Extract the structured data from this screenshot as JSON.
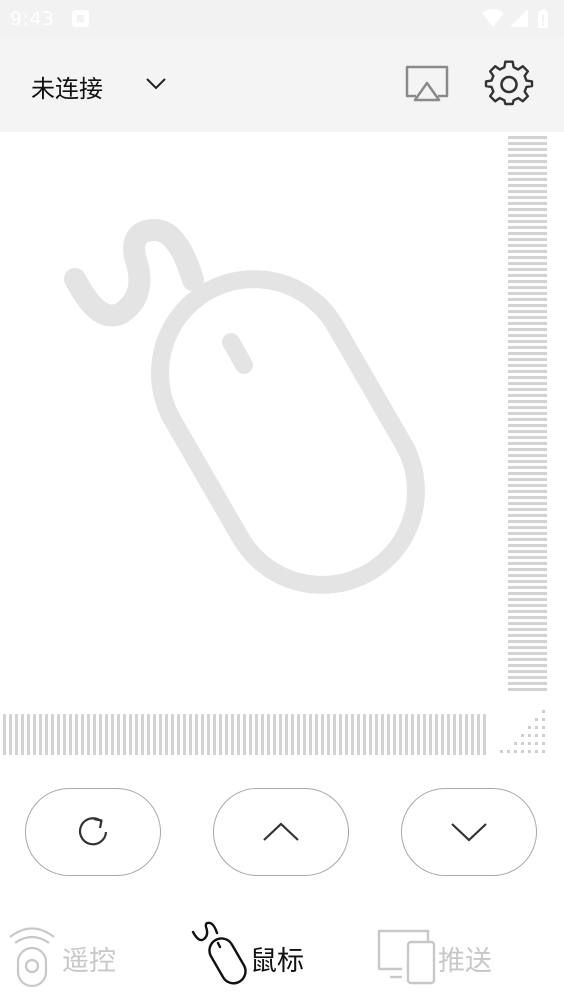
{
  "status_bar": {
    "time": "9:43"
  },
  "header": {
    "connection_label": "未连接"
  },
  "icons": {
    "mouse_art": "mouse-icon",
    "cast": "cast-icon",
    "settings": "gear-icon",
    "refresh": "refresh-icon",
    "up": "chevron-up-icon",
    "down": "chevron-down-icon"
  },
  "nav": {
    "items": [
      {
        "label": "遥控",
        "icon": "remote-icon",
        "active": false
      },
      {
        "label": "鼠标",
        "icon": "mouse-icon",
        "active": true
      },
      {
        "label": "推送",
        "icon": "devices-icon",
        "active": false
      }
    ]
  },
  "colors": {
    "header_bg": "#f4f4f4",
    "status_bg": "#f2f2f2",
    "illustration": "#e4e4e4",
    "active_text": "#111111",
    "inactive_text": "#c8c8c8",
    "button_border": "#a9a9a9"
  }
}
